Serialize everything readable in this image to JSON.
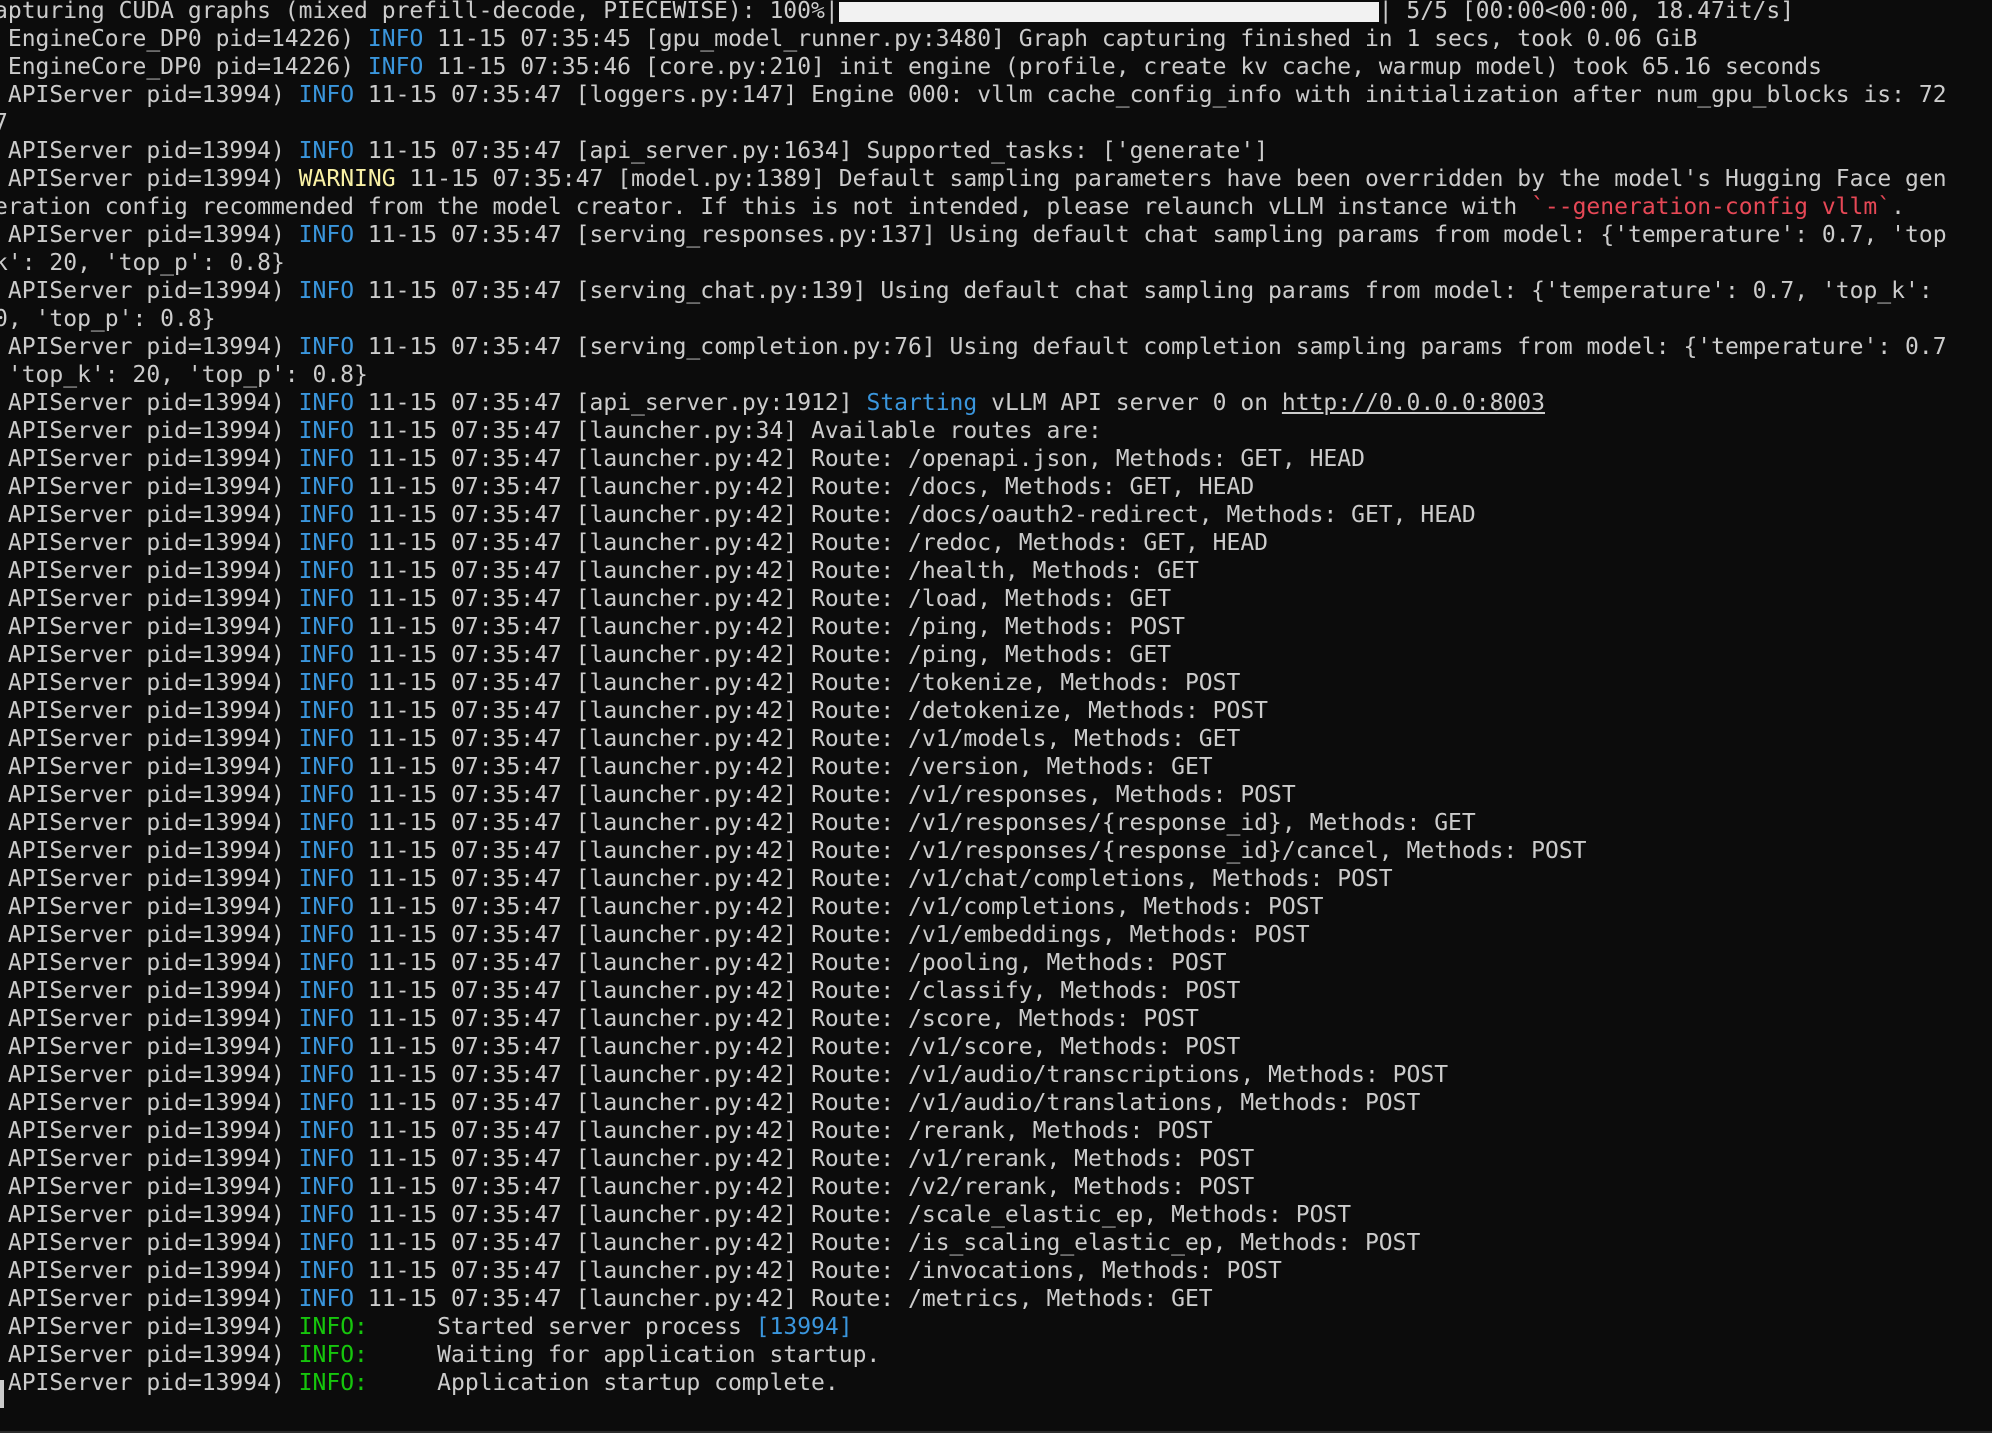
{
  "colors": {
    "background": "#0c0c0c",
    "text": "#cccccc",
    "info": "#3a96dd",
    "warning": "#f9f1a5",
    "uvicorn_info": "#16c60c",
    "highlight_red": "#e74856"
  },
  "header_lines": [
    {
      "t": "pre",
      "prefix": "apturing CUDA graphs (mixed prefill-decode, PIECEWISE): 100%|",
      "suffix": "| 5/5 [00:00<00:00, 18.47it/s]"
    },
    {
      "t": "log",
      "proc": "EngineCore_DP0 pid=14226)",
      "level": "INFO",
      "ts": "11-15 07:35:45",
      "src": "[gpu_model_runner.py:3480]",
      "msg": "Graph capturing finished in 1 secs, took 0.06 GiB"
    },
    {
      "t": "log",
      "proc": "EngineCore_DP0 pid=14226)",
      "level": "INFO",
      "ts": "11-15 07:35:46",
      "src": "[core.py:210]",
      "msg": "init engine (profile, create kv cache, warmup model) took 65.16 seconds"
    },
    {
      "t": "log",
      "proc": "APIServer pid=13994)",
      "level": "INFO",
      "ts": "11-15 07:35:47",
      "src": "[loggers.py:147]",
      "msg": "Engine 000: vllm cache_config_info with initialization after num_gpu_blocks is: 72"
    },
    {
      "t": "plain",
      "text": "7"
    },
    {
      "t": "log",
      "proc": "APIServer pid=13994)",
      "level": "INFO",
      "ts": "11-15 07:35:47",
      "src": "[api_server.py:1634]",
      "msg": "Supported_tasks: ['generate']"
    },
    {
      "t": "log",
      "proc": "APIServer pid=13994)",
      "level": "WARNING",
      "ts": "11-15 07:35:47",
      "src": "[model.py:1389]",
      "msg": "Default sampling parameters have been overridden by the model's Hugging Face gen"
    },
    {
      "t": "warncont",
      "text": "eration config recommended from the model creator. If this is not intended, please relaunch vLLM instance with ",
      "red": "`--generation-config vllm`",
      "tail": "."
    },
    {
      "t": "log",
      "proc": "APIServer pid=13994)",
      "level": "INFO",
      "ts": "11-15 07:35:47",
      "src": "[serving_responses.py:137]",
      "msg": "Using default chat sampling params from model: {'temperature': 0.7, 'top"
    },
    {
      "t": "plain",
      "text": "k': 20, 'top_p': 0.8}"
    },
    {
      "t": "log",
      "proc": "APIServer pid=13994)",
      "level": "INFO",
      "ts": "11-15 07:35:47",
      "src": "[serving_chat.py:139]",
      "msg": "Using default chat sampling params from model: {'temperature': 0.7, 'top_k':"
    },
    {
      "t": "plain",
      "text": "0, 'top_p': 0.8}"
    },
    {
      "t": "log",
      "proc": "APIServer pid=13994)",
      "level": "INFO",
      "ts": "11-15 07:35:47",
      "src": "[serving_completion.py:76]",
      "msg": "Using default completion sampling params from model: {'temperature': 0.7"
    },
    {
      "t": "plain",
      "text": " 'top_k': 20, 'top_p': 0.8}"
    },
    {
      "t": "start",
      "proc": "APIServer pid=13994)",
      "level": "INFO",
      "ts": "11-15 07:35:47",
      "src": "[api_server.py:1912]",
      "kw": "Starting",
      "mid": " vLLM API server 0 on ",
      "url": "http://0.0.0.0:8003"
    },
    {
      "t": "log",
      "proc": "APIServer pid=13994)",
      "level": "INFO",
      "ts": "11-15 07:35:47",
      "src": "[launcher.py:34]",
      "msg": "Available routes are:"
    }
  ],
  "route_proc": "APIServer pid=13994)",
  "route_level": "INFO",
  "route_ts": "11-15 07:35:47",
  "route_src": "[launcher.py:42]",
  "routes": [
    "/openapi.json, Methods: GET, HEAD",
    "/docs, Methods: GET, HEAD",
    "/docs/oauth2-redirect, Methods: GET, HEAD",
    "/redoc, Methods: GET, HEAD",
    "/health, Methods: GET",
    "/load, Methods: GET",
    "/ping, Methods: POST",
    "/ping, Methods: GET",
    "/tokenize, Methods: POST",
    "/detokenize, Methods: POST",
    "/v1/models, Methods: GET",
    "/version, Methods: GET",
    "/v1/responses, Methods: POST",
    "/v1/responses/{response_id}, Methods: GET",
    "/v1/responses/{response_id}/cancel, Methods: POST",
    "/v1/chat/completions, Methods: POST",
    "/v1/completions, Methods: POST",
    "/v1/embeddings, Methods: POST",
    "/pooling, Methods: POST",
    "/classify, Methods: POST",
    "/score, Methods: POST",
    "/v1/score, Methods: POST",
    "/v1/audio/transcriptions, Methods: POST",
    "/v1/audio/translations, Methods: POST",
    "/rerank, Methods: POST",
    "/v1/rerank, Methods: POST",
    "/v2/rerank, Methods: POST",
    "/scale_elastic_ep, Methods: POST",
    "/is_scaling_elastic_ep, Methods: POST",
    "/invocations, Methods: POST",
    "/metrics, Methods: GET"
  ],
  "footer_lines": [
    {
      "proc": "APIServer pid=13994)",
      "level": "INFO:",
      "msg": "Started server process ",
      "pid": "[13994]"
    },
    {
      "proc": "APIServer pid=13994)",
      "level": "INFO:",
      "msg": "Waiting for application startup.",
      "pid": ""
    },
    {
      "proc": "APIServer pid=13994)",
      "level": "INFO:",
      "msg": "Application startup complete.",
      "pid": ""
    }
  ]
}
